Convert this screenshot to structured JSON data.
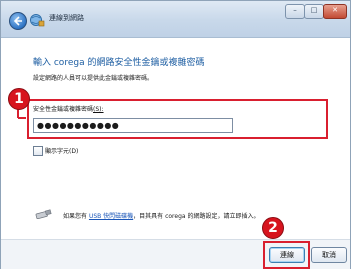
{
  "window": {
    "title": "連線到網路",
    "controls": [
      "minimize",
      "maximize",
      "close"
    ]
  },
  "header": {
    "heading": "輸入 corega 的網路安全性金鑰或複雜密碼",
    "instruction": "設定網路的人員可以提供此金鑰或複雜密碼。"
  },
  "form": {
    "field_label": "安全性金鑰或複雜密碼",
    "field_label_hotkey": "(S):",
    "password_value": "●●●●●●●●●●●",
    "show_characters_label": "顯示字元(D)"
  },
  "usb_note": {
    "prefix": "如果您有",
    "link_text": "USB 快閃磁碟機",
    "suffix": "，目其具有 corega 的網路設定，請立即插入。"
  },
  "buttons": {
    "connect": "連線",
    "cancel": "取消"
  },
  "annotations": {
    "step1": "1",
    "step2": "2",
    "color": "#d91f2f"
  }
}
